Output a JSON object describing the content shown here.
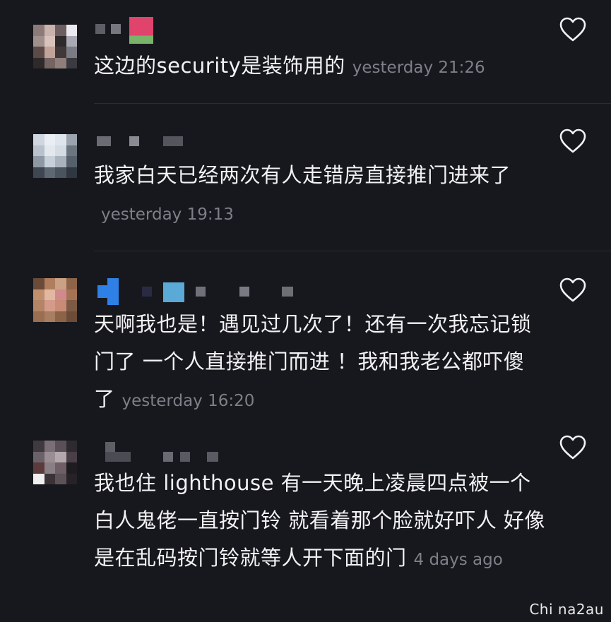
{
  "comments": [
    {
      "text": "这边的security是装饰用的",
      "timestamp": "yesterday 21:26",
      "avatar_colors": [
        "#8b7a78",
        "#c9b3ad",
        "#6d5f60",
        "#e9e9ef",
        "#a08f8a",
        "#d8c2bb",
        "#2e2a2c",
        "#a9a9b4",
        "#5b4a47",
        "#c1a39a",
        "#403838",
        "#7b7b85",
        "#2f2a2a",
        "#756462",
        "#8f7e7a",
        "#3a3a40"
      ],
      "name_colors": [
        "#5e5e66",
        "#77777f",
        "#e0436c"
      ]
    },
    {
      "text": "我家白天已经两次有人走错房直接推门进来了",
      "timestamp": "yesterday 19:13",
      "avatar_colors": [
        "#cfd6df",
        "#e9eef4",
        "#dfe5ec",
        "#9aa3ae",
        "#b9c2cc",
        "#e3e8ee",
        "#d4dbe3",
        "#6b7580",
        "#8e98a3",
        "#c7d0d9",
        "#aab3bd",
        "#55606c",
        "#3d4651",
        "#5e6873",
        "#4a545f",
        "#2f3740"
      ],
      "name_colors": [
        "#6b6b73",
        "#8a8a92",
        "#55555d",
        "#77777f"
      ]
    },
    {
      "text": "天啊我也是！遇见过几次了！还有一次我忘记锁门了 一个人直接推门而进 ！我和我老公都吓傻了",
      "timestamp": "yesterday 16:20",
      "avatar_colors": [
        "#6a4a38",
        "#b07d5e",
        "#caa184",
        "#8d6448",
        "#c08f6e",
        "#e3b8a3",
        "#d18a8c",
        "#a57256",
        "#b48466",
        "#d49a8a",
        "#c98b76",
        "#7c5a44",
        "#9a6e50",
        "#a87e62",
        "#8b6448",
        "#6c4c38"
      ],
      "name_colors": [
        "#2f80e6",
        "#2a2a44",
        "#5aa9d6",
        "#707078",
        "#7a7a82",
        "#6e6e76"
      ]
    },
    {
      "text": "我也住 lighthouse 有一天晚上凌晨四点被一个白人鬼佬一直按门铃 就看着那个脸就好吓人 好像是在乱码按门铃就等人开下面的门",
      "timestamp": "4 days ago",
      "avatar_colors": [
        "#3f3a40",
        "#7a6f75",
        "#5b4f58",
        "#2d2a30",
        "#6b6269",
        "#9a8d93",
        "#b3a8ad",
        "#4a3f46",
        "#5c3b3d",
        "#8a7f85",
        "#6f5e65",
        "#1f1c20",
        "#efefef",
        "#3a3236",
        "#5d5258",
        "#262226"
      ],
      "name_colors": [
        "#5e5e66",
        "#4b4b53",
        "#6a6a72",
        "#5a5a62"
      ]
    }
  ],
  "watermark": "Chi na2au",
  "icons": {
    "like": "heart-outline-icon"
  }
}
